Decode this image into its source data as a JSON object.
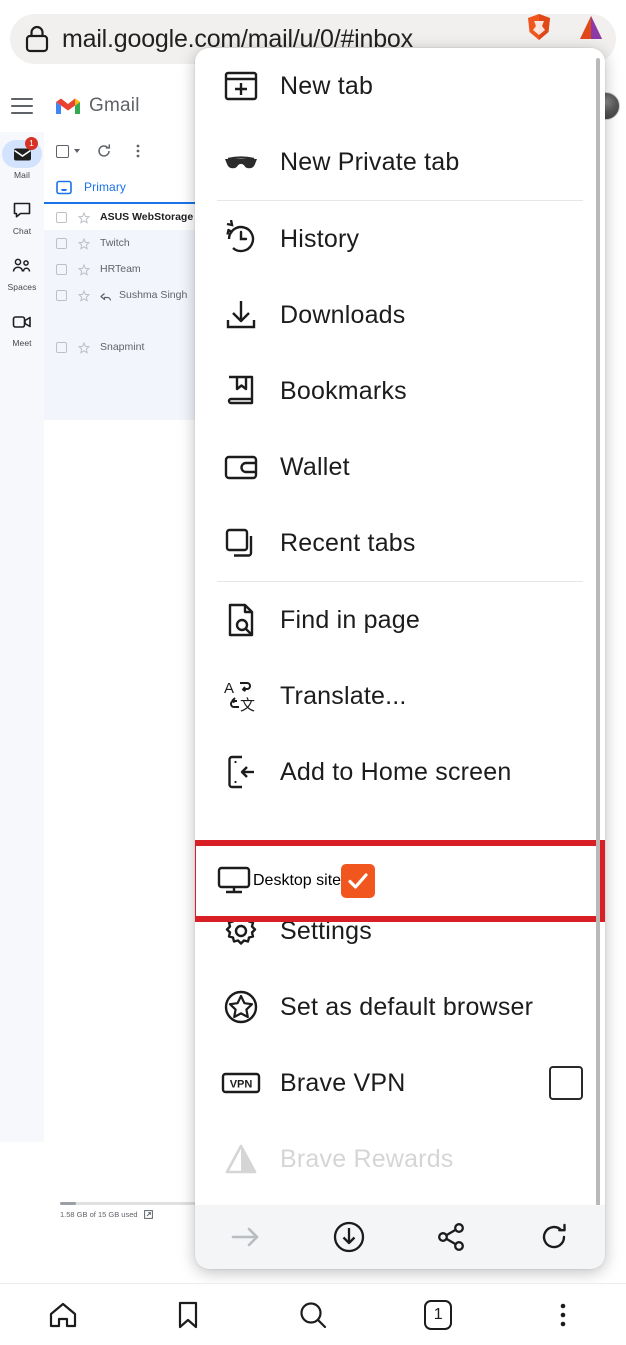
{
  "browser": {
    "name": "Brave",
    "urlbar": {
      "url": "mail.google.com/mail/u/0/#inbox",
      "lock_icon": "lock-icon",
      "shield_icon": "brave-shield-icon",
      "logo_icon": "brave-logo-icon"
    },
    "bottom_nav": [
      {
        "name": "home",
        "icon": "home-icon",
        "label": ""
      },
      {
        "name": "bookmarks",
        "icon": "bookmark-icon",
        "label": ""
      },
      {
        "name": "search",
        "icon": "search-icon",
        "label": ""
      },
      {
        "name": "tab-switcher",
        "icon": "tab-count-icon",
        "label": "1"
      },
      {
        "name": "more-menu",
        "icon": "three-dot-icon",
        "label": ""
      }
    ]
  },
  "gmail": {
    "app_name": "Gmail",
    "menu_icon": "hamburger-icon",
    "avatar": "account-avatar",
    "rail": [
      {
        "label": "Mail",
        "icon": "mail-icon",
        "badge": "1",
        "active": true
      },
      {
        "label": "Chat",
        "icon": "chat-icon",
        "badge": "",
        "active": false
      },
      {
        "label": "Spaces",
        "icon": "spaces-icon",
        "badge": "",
        "active": false
      },
      {
        "label": "Meet",
        "icon": "meet-icon",
        "badge": "",
        "active": false
      }
    ],
    "toolbar": {
      "select_all_icon": "checkbox-icon",
      "select_caret_icon": "chevron-down-icon",
      "refresh_icon": "refresh-icon",
      "more_icon": "three-dot-icon"
    },
    "tab": {
      "label": "Primary",
      "icon": "inbox-icon"
    },
    "messages": [
      {
        "sender": "ASUS WebStorage",
        "unread": true,
        "replied": false
      },
      {
        "sender": "Twitch",
        "unread": false,
        "replied": false
      },
      {
        "sender": "HRTeam",
        "unread": false,
        "replied": false
      },
      {
        "sender": "Sushma Singh",
        "unread": false,
        "replied": true
      },
      {
        "sender": "Snapmint",
        "unread": false,
        "replied": false
      }
    ],
    "storage": {
      "text": "1.58 GB of 15 GB used",
      "link_icon": "external-link-icon"
    }
  },
  "menu": {
    "items": [
      {
        "label": "New tab",
        "icon": "new-tab-icon",
        "control": "none",
        "highlighted": false,
        "faded": false
      },
      {
        "label": "New Private tab",
        "icon": "private-tab-icon",
        "control": "none",
        "highlighted": false,
        "faded": false
      },
      {
        "label": "History",
        "icon": "history-icon",
        "control": "none",
        "highlighted": false,
        "faded": false
      },
      {
        "label": "Downloads",
        "icon": "download-icon",
        "control": "none",
        "highlighted": false,
        "faded": false
      },
      {
        "label": "Bookmarks",
        "icon": "bookmarks-icon",
        "control": "none",
        "highlighted": false,
        "faded": false
      },
      {
        "label": "Wallet",
        "icon": "wallet-icon",
        "control": "none",
        "highlighted": false,
        "faded": false
      },
      {
        "label": "Recent tabs",
        "icon": "recent-tabs-icon",
        "control": "none",
        "highlighted": false,
        "faded": false
      },
      {
        "label": "Find in page",
        "icon": "find-in-page-icon",
        "control": "none",
        "highlighted": false,
        "faded": false
      },
      {
        "label": "Translate...",
        "icon": "translate-icon",
        "control": "none",
        "highlighted": false,
        "faded": false
      },
      {
        "label": "Add to Home screen",
        "icon": "add-to-home-icon",
        "control": "none",
        "highlighted": false,
        "faded": false
      },
      {
        "label": "Desktop site",
        "icon": "desktop-site-icon",
        "control": "checkbox-on",
        "highlighted": true,
        "faded": false
      },
      {
        "label": "Settings",
        "icon": "settings-gear-icon",
        "control": "none",
        "highlighted": false,
        "faded": false
      },
      {
        "label": "Set as default browser",
        "icon": "default-browser-icon",
        "control": "none",
        "highlighted": false,
        "faded": false
      },
      {
        "label": "Brave VPN",
        "icon": "vpn-icon",
        "control": "checkbox-off",
        "highlighted": false,
        "faded": false
      },
      {
        "label": "Brave Rewards",
        "icon": "brave-rewards-icon",
        "control": "none",
        "highlighted": false,
        "faded": true
      }
    ],
    "bottom_actions": [
      {
        "name": "forward",
        "icon": "arrow-right-icon",
        "disabled": true
      },
      {
        "name": "download",
        "icon": "download-circle-icon",
        "disabled": false
      },
      {
        "name": "share",
        "icon": "share-icon",
        "disabled": false
      },
      {
        "name": "reload",
        "icon": "reload-icon",
        "disabled": false
      }
    ],
    "highlight_color": "#d81f26",
    "checkbox_on_color": "#f0561d"
  }
}
